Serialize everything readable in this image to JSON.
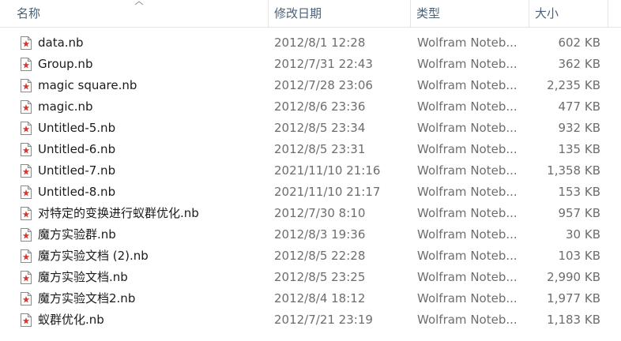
{
  "columns": {
    "name": "名称",
    "date": "修改日期",
    "type": "类型",
    "size": "大小"
  },
  "sort": {
    "column": "name",
    "icon": "sort-up-chevron"
  },
  "file_icon": "mathematica-notebook-icon",
  "accent_color": "#d7372c",
  "files": [
    {
      "name": "data.nb",
      "date": "2012/8/1 12:28",
      "type": "Wolfram Noteb...",
      "size": "602 KB"
    },
    {
      "name": "Group.nb",
      "date": "2012/7/31 22:43",
      "type": "Wolfram Noteb...",
      "size": "362 KB"
    },
    {
      "name": "magic square.nb",
      "date": "2012/7/28 23:06",
      "type": "Wolfram Noteb...",
      "size": "2,235 KB"
    },
    {
      "name": "magic.nb",
      "date": "2012/8/6 23:36",
      "type": "Wolfram Noteb...",
      "size": "477 KB"
    },
    {
      "name": "Untitled-5.nb",
      "date": "2012/8/5 23:34",
      "type": "Wolfram Noteb...",
      "size": "932 KB"
    },
    {
      "name": "Untitled-6.nb",
      "date": "2012/8/5 23:31",
      "type": "Wolfram Noteb...",
      "size": "135 KB"
    },
    {
      "name": "Untitled-7.nb",
      "date": "2021/11/10 21:16",
      "type": "Wolfram Noteb...",
      "size": "1,358 KB"
    },
    {
      "name": "Untitled-8.nb",
      "date": "2021/11/10 21:17",
      "type": "Wolfram Noteb...",
      "size": "153 KB"
    },
    {
      "name": "对特定的变换进行蚁群优化.nb",
      "date": "2012/7/30 8:10",
      "type": "Wolfram Noteb...",
      "size": "957 KB"
    },
    {
      "name": "魔方实验群.nb",
      "date": "2012/8/3 19:36",
      "type": "Wolfram Noteb...",
      "size": "30 KB"
    },
    {
      "name": "魔方实验文档 (2).nb",
      "date": "2012/8/5 22:28",
      "type": "Wolfram Noteb...",
      "size": "103 KB"
    },
    {
      "name": "魔方实验文档.nb",
      "date": "2012/8/5 23:25",
      "type": "Wolfram Noteb...",
      "size": "2,990 KB"
    },
    {
      "name": "魔方实验文档2.nb",
      "date": "2012/8/4 18:12",
      "type": "Wolfram Noteb...",
      "size": "1,977 KB"
    },
    {
      "name": "蚁群优化.nb",
      "date": "2012/7/21 23:19",
      "type": "Wolfram Noteb...",
      "size": "1,183 KB"
    }
  ]
}
